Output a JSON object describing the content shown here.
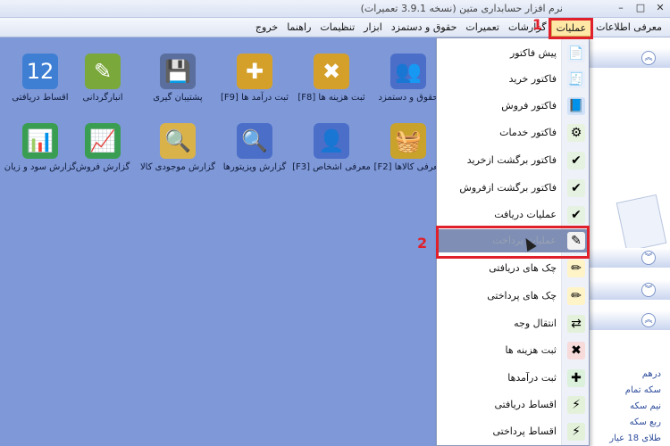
{
  "window": {
    "title": "نرم افزار حسابداری متین (نسخه 3.9.1 تعمیرات)",
    "controls": [
      "✕",
      "□",
      "–"
    ]
  },
  "menubar": {
    "items": [
      {
        "label": "معرفی اطلاعات"
      },
      {
        "label": "عملیات",
        "active": true
      },
      {
        "label": "گزارشات"
      },
      {
        "label": "تعمیرات"
      },
      {
        "label": "حقوق و دستمزد"
      },
      {
        "label": "ابزار"
      },
      {
        "label": "تنظیمات"
      },
      {
        "label": "راهنما"
      },
      {
        "label": "خروج"
      }
    ]
  },
  "desktop": {
    "icons": [
      {
        "label": "حقوق و دستمزد",
        "glyph": "👥",
        "color": "#4b6ec9",
        "icon": "payroll-icon"
      },
      {
        "label": "ثبت هزینه ها [F8]",
        "glyph": "✖",
        "color": "#d4a02a",
        "icon": "expense-icon"
      },
      {
        "label": "ثبت درآمد ها [F9]",
        "glyph": "✚",
        "color": "#d4a02a",
        "icon": "income-icon"
      },
      {
        "label": "پشتیبان گیری",
        "glyph": "💾",
        "color": "#5a6f9e",
        "icon": "backup-icon"
      },
      {
        "label": "انبارگردانی",
        "glyph": "✎",
        "color": "#7aa83a",
        "icon": "inventory-icon"
      },
      {
        "label": "اقساط دریافتی",
        "glyph": "12",
        "color": "#3f7fd3",
        "icon": "calendar-icon"
      },
      {
        "label": "معرفی کالاها [F2]",
        "glyph": "🧺",
        "color": "#c9a22c",
        "icon": "basket-icon"
      },
      {
        "label": "معرفی اشخاص [F3]",
        "glyph": "👤",
        "color": "#4b6ec9",
        "icon": "add-person-icon"
      },
      {
        "label": "گزارش ویزیتورها",
        "glyph": "🔍",
        "color": "#4b6ec9",
        "icon": "visitor-report-icon"
      },
      {
        "label": "گزارش موجودی کالا",
        "glyph": "🔍",
        "color": "#d9b24a",
        "icon": "stock-report-icon"
      },
      {
        "label": "گزارش فروش",
        "glyph": "📈",
        "color": "#3a9e52",
        "icon": "sales-report-icon"
      },
      {
        "label": "گزارش سود و زیان",
        "glyph": "📊",
        "color": "#3a9e52",
        "icon": "profit-report-icon"
      }
    ]
  },
  "sidepane": {
    "texts": [
      "درهم",
      "سکه تمام",
      "نیم سکه",
      "ربع سکه",
      "طلای 18 عیار"
    ]
  },
  "dropdown": {
    "items": [
      {
        "label": "پیش فاکتور",
        "glyph": "📄",
        "color": "#e7eef9",
        "icon": "pre-invoice-icon"
      },
      {
        "label": "فاکتور خرید",
        "glyph": "🧾",
        "color": "#e7eef9",
        "icon": "purchase-invoice-icon"
      },
      {
        "label": "فاکتور فروش",
        "glyph": "📘",
        "color": "#cfe0f7",
        "icon": "sales-invoice-icon"
      },
      {
        "label": "فاکتور خدمات",
        "glyph": "⚙",
        "color": "#e7f2df",
        "icon": "service-invoice-icon"
      },
      {
        "label": "فاکتور برگشت ازخرید",
        "glyph": "✔",
        "color": "#e6f2e1",
        "icon": "purchase-return-icon"
      },
      {
        "label": "فاکتور برگشت ازفروش",
        "glyph": "✔",
        "color": "#e6f2e1",
        "icon": "sales-return-icon"
      },
      {
        "label": "عملیات دریافت",
        "glyph": "✔",
        "color": "#e6f2e1",
        "icon": "receive-icon"
      },
      {
        "label": "عملیات پرداخت",
        "glyph": "✎",
        "color": "#f2f2f2",
        "icon": "payment-icon",
        "hover": true,
        "disabled": true
      },
      {
        "label": "چک های دریافتی",
        "glyph": "✏",
        "color": "#fff4c8",
        "icon": "received-cheques-icon"
      },
      {
        "label": "چک های پرداختی",
        "glyph": "✏",
        "color": "#fff4c8",
        "icon": "paid-cheques-icon"
      },
      {
        "label": "انتقال وجه",
        "glyph": "⇄",
        "color": "#e3f1da",
        "icon": "transfer-icon"
      },
      {
        "label": "ثبت هزینه ها",
        "glyph": "✖",
        "color": "#f7dada",
        "icon": "record-expense-icon"
      },
      {
        "label": "ثبت درآمدها",
        "glyph": "✚",
        "color": "#dcf1dc",
        "icon": "record-income-icon"
      },
      {
        "label": "اقساط دریافتی",
        "glyph": "⚡",
        "color": "#e3f1da",
        "icon": "received-installments-icon"
      },
      {
        "label": "اقساط پرداختی",
        "glyph": "⚡",
        "color": "#e3f1da",
        "icon": "paid-installments-icon"
      }
    ]
  },
  "annotations": {
    "one": "1",
    "two": "2"
  }
}
